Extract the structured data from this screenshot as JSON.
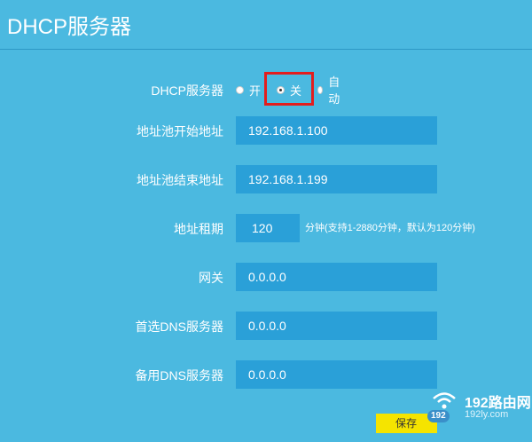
{
  "page": {
    "title": "DHCP服务器"
  },
  "dhcp": {
    "label": "DHCP服务器",
    "options": [
      {
        "label": "开",
        "checked": false
      },
      {
        "label": "关",
        "checked": true
      },
      {
        "label": "自动",
        "checked": false
      }
    ]
  },
  "fields": {
    "pool_start": {
      "label": "地址池开始地址",
      "value": "192.168.1.100"
    },
    "pool_end": {
      "label": "地址池结束地址",
      "value": "192.168.1.199"
    },
    "lease": {
      "label": "地址租期",
      "value": "120",
      "note": "分钟(支持1-2880分钟，默认为120分钟)"
    },
    "gateway": {
      "label": "网关",
      "value": "0.0.0.0"
    },
    "dns_primary": {
      "label": "首选DNS服务器",
      "value": "0.0.0.0"
    },
    "dns_secondary": {
      "label": "备用DNS服务器",
      "value": "0.0.0.0"
    }
  },
  "actions": {
    "save_label": "保存"
  },
  "watermark": {
    "main": "192路由网",
    "sub": "192ly.com",
    "badge": "192"
  },
  "colors": {
    "background": "#4bb9e0",
    "input": "#2aa0d8",
    "highlight": "#e31d1d",
    "save_button": "#f5e400"
  }
}
